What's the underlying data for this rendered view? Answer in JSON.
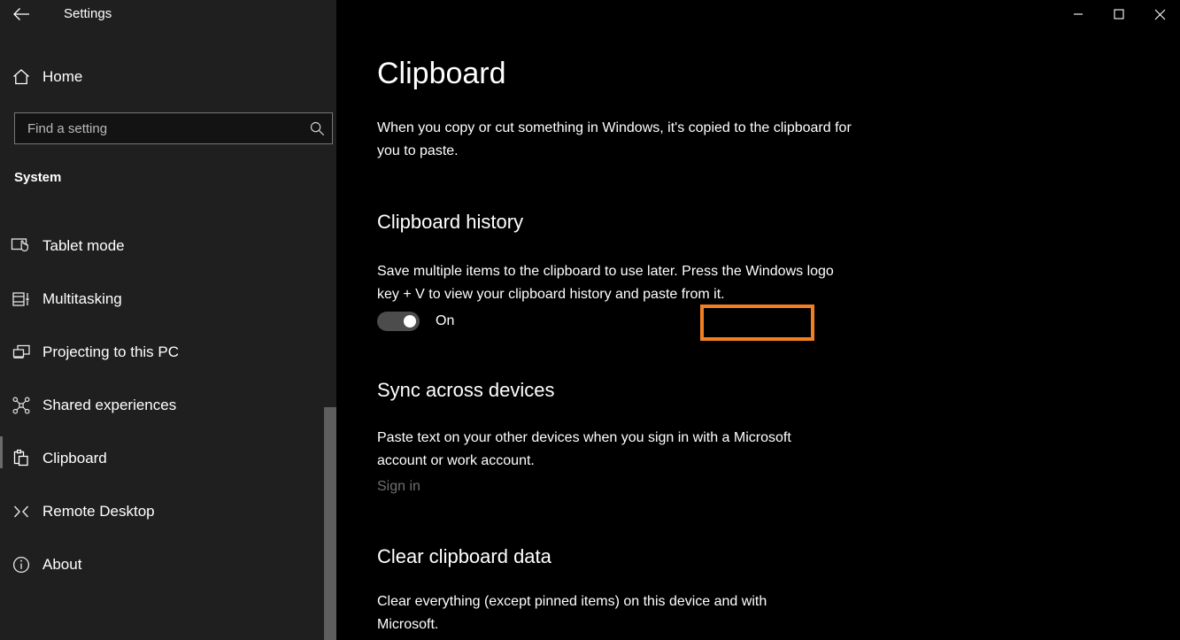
{
  "titlebar": {
    "back_label": "back-arrow",
    "title": "Settings",
    "minimize": "minimize",
    "maximize": "maximize",
    "close": "close"
  },
  "sidebar": {
    "home": {
      "label": "Home",
      "icon": "home-icon"
    },
    "search": {
      "placeholder": "Find a setting",
      "value": "",
      "icon": "search-icon"
    },
    "group_label": "System",
    "items": [
      {
        "label": "Tablet mode",
        "icon": "tablet-mode-icon",
        "selected": false
      },
      {
        "label": "Multitasking",
        "icon": "multitasking-icon",
        "selected": false
      },
      {
        "label": "Projecting to this PC",
        "icon": "projecting-icon",
        "selected": false
      },
      {
        "label": "Shared experiences",
        "icon": "shared-experiences-icon",
        "selected": false
      },
      {
        "label": "Clipboard",
        "icon": "clipboard-icon",
        "selected": true
      },
      {
        "label": "Remote Desktop",
        "icon": "remote-desktop-icon",
        "selected": false
      },
      {
        "label": "About",
        "icon": "info-icon",
        "selected": false
      }
    ]
  },
  "main": {
    "title": "Clipboard",
    "intro": "When you copy or cut something in Windows, it's copied to the clipboard for you to paste.",
    "sections": [
      {
        "heading": "Clipboard history",
        "description": "Save multiple items to the clipboard to use later. Press the Windows logo key + V to view your clipboard history and paste from it.",
        "toggle": {
          "state": "On",
          "checked": true,
          "highlighted": true
        }
      },
      {
        "heading": "Sync across devices",
        "description": "Paste text on your other devices when you sign in with a Microsoft account or work account.",
        "link": "Sign in"
      },
      {
        "heading": "Clear clipboard data",
        "description": "Clear everything (except pinned items) on this device and with Microsoft."
      }
    ]
  },
  "colors": {
    "sidebar_bg": "#1f1f1f",
    "content_bg": "#000000",
    "highlight_orange": "#f28022",
    "toggle_track": "#4c4c4c",
    "disabled_text": "#6f6f6f",
    "scrollbar_thumb": "#5e5e5e"
  }
}
